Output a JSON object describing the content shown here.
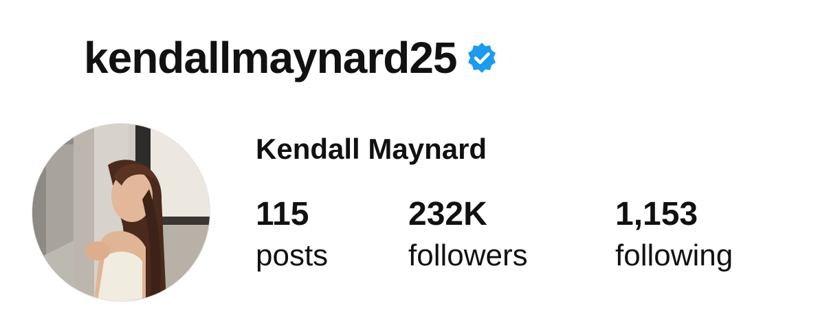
{
  "profile": {
    "username": "kendallmaynard25",
    "verified_icon": "verified-badge-icon",
    "display_name": "Kendall Maynard",
    "avatar_icon": "profile-photo"
  },
  "stats": {
    "posts": {
      "count": "115",
      "label": "posts"
    },
    "followers": {
      "count": "232K",
      "label": "followers"
    },
    "following": {
      "count": "1,153",
      "label": "following"
    }
  },
  "colors": {
    "verified_blue": "#1d9bf0",
    "text": "#111111",
    "background": "#ffffff"
  }
}
